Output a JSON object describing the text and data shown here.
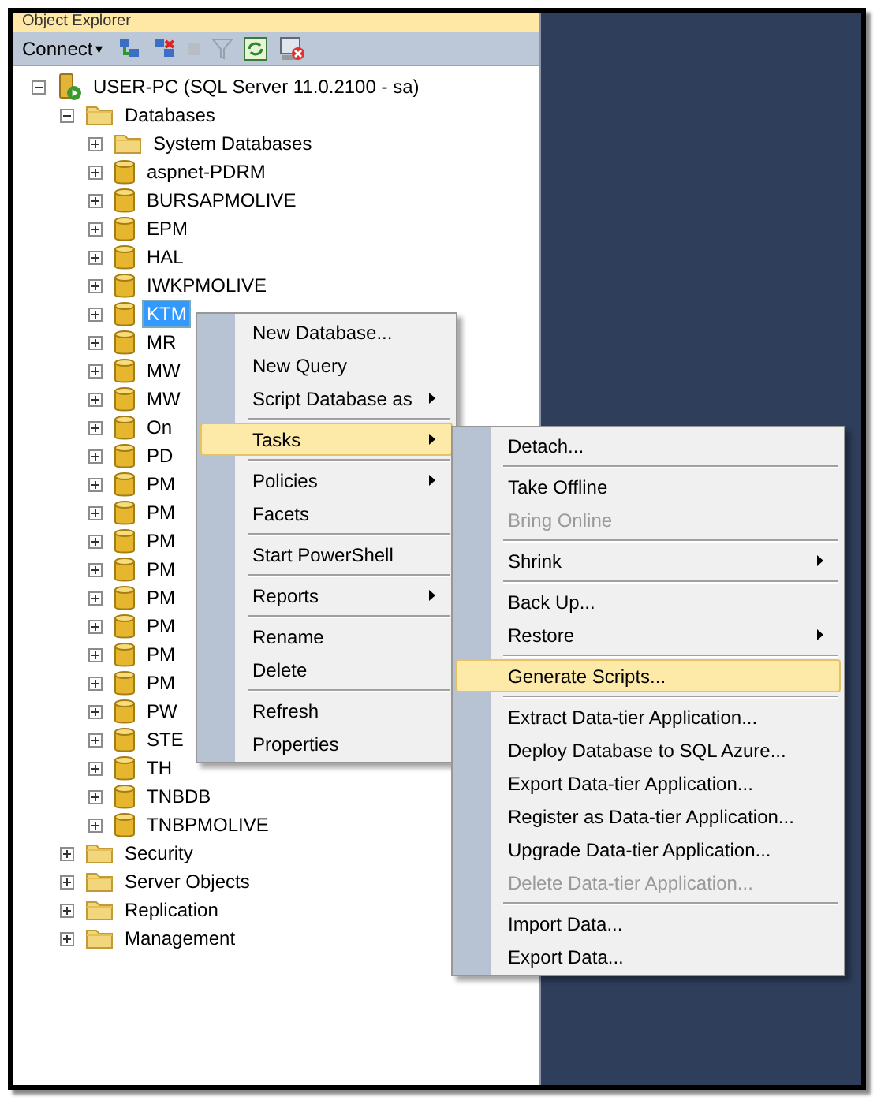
{
  "panel": {
    "title": "Object Explorer"
  },
  "toolbar": {
    "connect_label": "Connect",
    "connect_caret": "▾"
  },
  "tree": [
    {
      "label": "USER-PC (SQL Server 11.0.2100 - sa)",
      "kind": "server",
      "expanded": true,
      "selected": false,
      "children": [
        {
          "label": "Databases",
          "kind": "folder",
          "expanded": true,
          "selected": false,
          "children": [
            {
              "label": "System Databases",
              "kind": "folder",
              "expanded": false,
              "selected": false
            },
            {
              "label": "aspnet-PDRM",
              "kind": "database",
              "expanded": false,
              "selected": false
            },
            {
              "label": "BURSAPMOLIVE",
              "kind": "database",
              "expanded": false,
              "selected": false
            },
            {
              "label": "EPM",
              "kind": "database",
              "expanded": false,
              "selected": false
            },
            {
              "label": "HAL",
              "kind": "database",
              "expanded": false,
              "selected": false
            },
            {
              "label": "IWKPMOLIVE",
              "kind": "database",
              "expanded": false,
              "selected": false
            },
            {
              "label": "KTM",
              "kind": "database",
              "expanded": false,
              "selected": true
            },
            {
              "label": "MR",
              "kind": "database",
              "expanded": false,
              "selected": false
            },
            {
              "label": "MW",
              "kind": "database",
              "expanded": false,
              "selected": false
            },
            {
              "label": "MW",
              "kind": "database",
              "expanded": false,
              "selected": false
            },
            {
              "label": "On",
              "kind": "database",
              "expanded": false,
              "selected": false
            },
            {
              "label": "PD",
              "kind": "database",
              "expanded": false,
              "selected": false
            },
            {
              "label": "PM",
              "kind": "database",
              "expanded": false,
              "selected": false
            },
            {
              "label": "PM",
              "kind": "database",
              "expanded": false,
              "selected": false
            },
            {
              "label": "PM",
              "kind": "database",
              "expanded": false,
              "selected": false
            },
            {
              "label": "PM",
              "kind": "database",
              "expanded": false,
              "selected": false
            },
            {
              "label": "PM",
              "kind": "database",
              "expanded": false,
              "selected": false
            },
            {
              "label": "PM",
              "kind": "database",
              "expanded": false,
              "selected": false
            },
            {
              "label": "PM",
              "kind": "database",
              "expanded": false,
              "selected": false
            },
            {
              "label": "PM",
              "kind": "database",
              "expanded": false,
              "selected": false
            },
            {
              "label": "PW",
              "kind": "database",
              "expanded": false,
              "selected": false
            },
            {
              "label": "STE",
              "kind": "database",
              "expanded": false,
              "selected": false
            },
            {
              "label": "TH",
              "kind": "database",
              "expanded": false,
              "selected": false
            },
            {
              "label": "TNBDB",
              "kind": "database",
              "expanded": false,
              "selected": false
            },
            {
              "label": "TNBPMOLIVE",
              "kind": "database",
              "expanded": false,
              "selected": false
            }
          ]
        },
        {
          "label": "Security",
          "kind": "folder",
          "expanded": false,
          "selected": false
        },
        {
          "label": "Server Objects",
          "kind": "folder",
          "expanded": false,
          "selected": false
        },
        {
          "label": "Replication",
          "kind": "folder",
          "expanded": false,
          "selected": false
        },
        {
          "label": "Management",
          "kind": "folder",
          "expanded": false,
          "selected": false
        }
      ]
    }
  ],
  "context_menu": {
    "items": [
      {
        "label": "New Database...",
        "submenu": false,
        "separator_before": false,
        "selected": false,
        "disabled": false
      },
      {
        "label": "New Query",
        "submenu": false,
        "separator_before": false,
        "selected": false,
        "disabled": false
      },
      {
        "label": "Script Database as",
        "submenu": true,
        "separator_before": false,
        "selected": false,
        "disabled": false
      },
      {
        "label": "Tasks",
        "submenu": true,
        "separator_before": true,
        "selected": true,
        "disabled": false
      },
      {
        "label": "Policies",
        "submenu": true,
        "separator_before": true,
        "selected": false,
        "disabled": false
      },
      {
        "label": "Facets",
        "submenu": false,
        "separator_before": false,
        "selected": false,
        "disabled": false
      },
      {
        "label": "Start PowerShell",
        "submenu": false,
        "separator_before": true,
        "selected": false,
        "disabled": false
      },
      {
        "label": "Reports",
        "submenu": true,
        "separator_before": true,
        "selected": false,
        "disabled": false
      },
      {
        "label": "Rename",
        "submenu": false,
        "separator_before": true,
        "selected": false,
        "disabled": false
      },
      {
        "label": "Delete",
        "submenu": false,
        "separator_before": false,
        "selected": false,
        "disabled": false
      },
      {
        "label": "Refresh",
        "submenu": false,
        "separator_before": true,
        "selected": false,
        "disabled": false
      },
      {
        "label": "Properties",
        "submenu": false,
        "separator_before": false,
        "selected": false,
        "disabled": false
      }
    ]
  },
  "tasks_submenu": {
    "items": [
      {
        "label": "Detach...",
        "submenu": false,
        "separator_before": false,
        "selected": false,
        "disabled": false
      },
      {
        "label": "Take Offline",
        "submenu": false,
        "separator_before": true,
        "selected": false,
        "disabled": false
      },
      {
        "label": "Bring Online",
        "submenu": false,
        "separator_before": false,
        "selected": false,
        "disabled": true
      },
      {
        "label": "Shrink",
        "submenu": true,
        "separator_before": true,
        "selected": false,
        "disabled": false
      },
      {
        "label": "Back Up...",
        "submenu": false,
        "separator_before": true,
        "selected": false,
        "disabled": false
      },
      {
        "label": "Restore",
        "submenu": true,
        "separator_before": false,
        "selected": false,
        "disabled": false
      },
      {
        "label": "Generate Scripts...",
        "submenu": false,
        "separator_before": true,
        "selected": true,
        "disabled": false
      },
      {
        "label": "Extract Data-tier Application...",
        "submenu": false,
        "separator_before": true,
        "selected": false,
        "disabled": false
      },
      {
        "label": "Deploy Database to SQL Azure...",
        "submenu": false,
        "separator_before": false,
        "selected": false,
        "disabled": false
      },
      {
        "label": "Export Data-tier Application...",
        "submenu": false,
        "separator_before": false,
        "selected": false,
        "disabled": false
      },
      {
        "label": "Register as Data-tier Application...",
        "submenu": false,
        "separator_before": false,
        "selected": false,
        "disabled": false
      },
      {
        "label": "Upgrade Data-tier Application...",
        "submenu": false,
        "separator_before": false,
        "selected": false,
        "disabled": false
      },
      {
        "label": "Delete Data-tier Application...",
        "submenu": false,
        "separator_before": false,
        "selected": false,
        "disabled": true
      },
      {
        "label": "Import Data...",
        "submenu": false,
        "separator_before": true,
        "selected": false,
        "disabled": false
      },
      {
        "label": "Export Data...",
        "submenu": false,
        "separator_before": false,
        "selected": false,
        "disabled": false
      }
    ]
  }
}
